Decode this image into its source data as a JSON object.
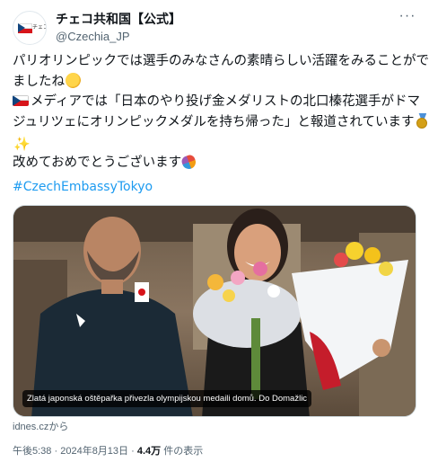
{
  "account": {
    "display_name": "チェコ共和国【公式】",
    "handle": "@Czechia_JP",
    "avatar_text": "チェコ共和国",
    "more_icon": "more-horizontal-icon"
  },
  "post": {
    "lines": [
      "パリオリンピックでは選手のみなさんの素晴らしい活躍をみることができ",
      "ましたね",
      "メディアでは「日本のやり投げ金メダリストの北口榛花選手がドマ",
      "ジュリツェにオリンピックメダルを持ち帰った」と報道されています",
      "",
      "改めておめでとうございます"
    ],
    "hashtag": "#CzechEmbassyTokyo",
    "emojis": [
      "clapping-hands",
      "czech-flag",
      "gold-medal",
      "sparkles",
      "confetti-ball"
    ]
  },
  "media": {
    "caption": "Zlatá japonská oštěpařka přivezla olympijskou medaili domů. Do Domažlic",
    "source": "idnes.czから"
  },
  "meta": {
    "time": "午後5:38",
    "separator": "·",
    "date": "2024年8月13日",
    "views_count": "4.4万",
    "views_label": "件の表示"
  },
  "colors": {
    "link": "#1d9bf0",
    "text": "#0f1419",
    "secondary": "#536471",
    "border": "#cfd9de"
  }
}
